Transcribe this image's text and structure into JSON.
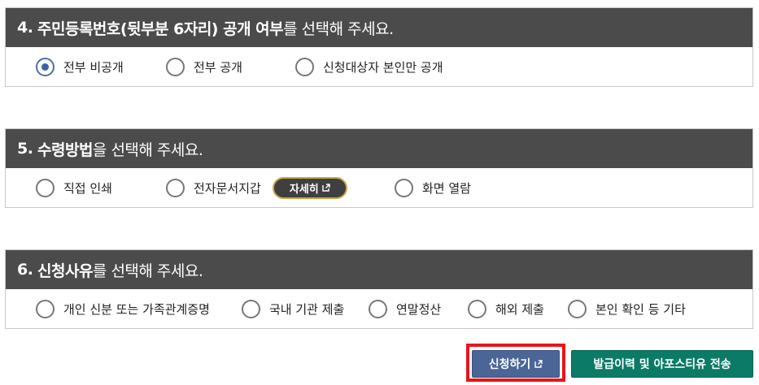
{
  "sections": [
    {
      "num": "4.",
      "bold_title": "주민등록번호(뒷부분 6자리) 공개 여부",
      "rest_title": "를 선택해 주세요.",
      "options": [
        {
          "label": "전부 비공개",
          "checked": true
        },
        {
          "label": "전부 공개",
          "checked": false
        },
        {
          "label": "신청대상자 본인만 공개",
          "checked": false
        }
      ]
    },
    {
      "num": "5.",
      "bold_title": "수령방법",
      "rest_title": "을 선택해 주세요.",
      "options": [
        {
          "label": "직접 인쇄",
          "checked": false
        },
        {
          "label": "전자문서지갑",
          "checked": false
        },
        {
          "label": "화면 열람",
          "checked": false
        }
      ],
      "detail_button": "자세히"
    },
    {
      "num": "6.",
      "bold_title": "신청사유",
      "rest_title": "를 선택해 주세요.",
      "options": [
        {
          "label": "개인 신분 또는 가족관계증명",
          "checked": false
        },
        {
          "label": "국내 기관 제출",
          "checked": false
        },
        {
          "label": "연말정산",
          "checked": false
        },
        {
          "label": "해외 제출",
          "checked": false
        },
        {
          "label": "본인 확인 등 기타",
          "checked": false
        }
      ]
    }
  ],
  "buttons": {
    "apply": "신청하기",
    "send": "발급이력 및 아포스티유 전송"
  },
  "colors": {
    "header_bg": "#4b4b4b",
    "radio_checked": "#3a63a8",
    "apply_bg": "#4a6596",
    "send_bg": "#0b7a66",
    "highlight": "#e8141b",
    "detail_border": "#c9a646"
  }
}
